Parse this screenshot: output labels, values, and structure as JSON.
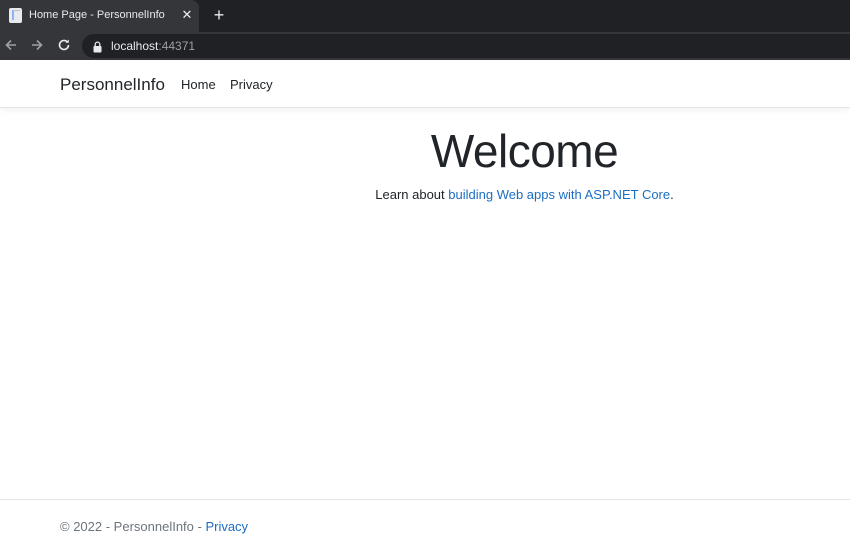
{
  "browser": {
    "tab_title": "Home Page - PersonnelInfo",
    "close_glyph": "✕",
    "new_tab_glyph": "+",
    "url_host": "localhost",
    "url_port": ":44371"
  },
  "navbar": {
    "brand": "PersonnelInfo",
    "links": [
      "Home",
      "Privacy"
    ]
  },
  "main": {
    "heading": "Welcome",
    "lead_prefix": "Learn about ",
    "lead_link": "building Web apps with ASP.NET Core",
    "lead_suffix": "."
  },
  "footer": {
    "text": "© 2022 - PersonnelInfo - ",
    "privacy_link": "Privacy"
  },
  "colors": {
    "link": "#1b6ec2",
    "text": "#212529",
    "muted": "#6c757d",
    "chrome_dark": "#202124",
    "chrome_mid": "#35363a"
  },
  "icons": [
    "document-icon",
    "close-icon",
    "plus-icon",
    "back-arrow-icon",
    "forward-arrow-icon",
    "reload-icon",
    "lock-icon"
  ]
}
